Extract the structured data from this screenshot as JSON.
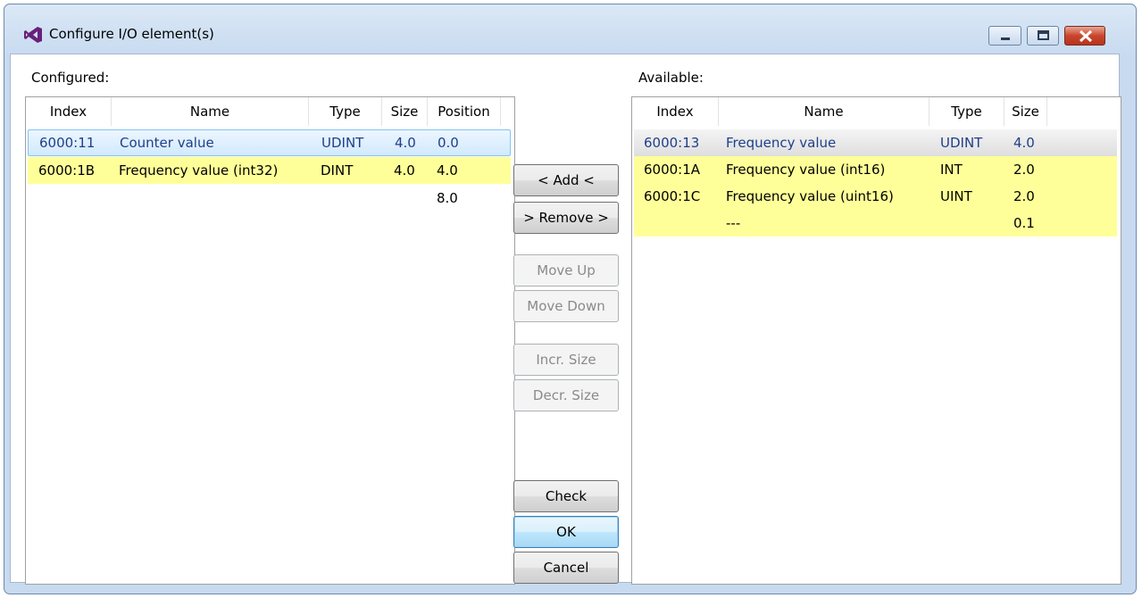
{
  "window": {
    "title": "Configure I/O element(s)",
    "icons": {
      "app": "visual-studio-icon",
      "minimize": "minimize-icon",
      "maximize": "maximize-icon",
      "close": "close-icon"
    }
  },
  "configured": {
    "label": "Configured:",
    "columns": [
      "Index",
      "Name",
      "Type",
      "Size",
      "Position"
    ],
    "rows": [
      {
        "index": "6000:11",
        "name": "Counter value",
        "type": "UDINT",
        "size": "4.0",
        "position": "0.0",
        "state": "selected"
      },
      {
        "index": "6000:1B",
        "name": "Frequency value (int32)",
        "type": "DINT",
        "size": "4.0",
        "position": "4.0",
        "state": "highlighted"
      },
      {
        "index": "",
        "name": "",
        "type": "",
        "size": "",
        "position": "8.0",
        "state": "normal"
      }
    ]
  },
  "available": {
    "label": "Available:",
    "columns": [
      "Index",
      "Name",
      "Type",
      "Size"
    ],
    "rows": [
      {
        "index": "6000:13",
        "name": "Frequency value",
        "type": "UDINT",
        "size": "4.0",
        "state": "selected-inactive"
      },
      {
        "index": "6000:1A",
        "name": "Frequency value (int16)",
        "type": "INT",
        "size": "2.0",
        "state": "highlighted"
      },
      {
        "index": "6000:1C",
        "name": "Frequency value (uint16)",
        "type": "UINT",
        "size": "2.0",
        "state": "highlighted"
      },
      {
        "index": "",
        "name": "---",
        "type": "",
        "size": "0.1",
        "state": "highlighted"
      }
    ]
  },
  "buttons": {
    "add": "< Add <",
    "remove": "> Remove >",
    "move_up": "Move Up",
    "move_down": "Move Down",
    "incr_size": "Incr. Size",
    "decr_size": "Decr. Size",
    "check": "Check",
    "ok": "OK",
    "cancel": "Cancel"
  },
  "colors": {
    "highlight_row": "#ffff99",
    "selection": "#d2e9fd",
    "title_gradient": "#c7daf0"
  }
}
